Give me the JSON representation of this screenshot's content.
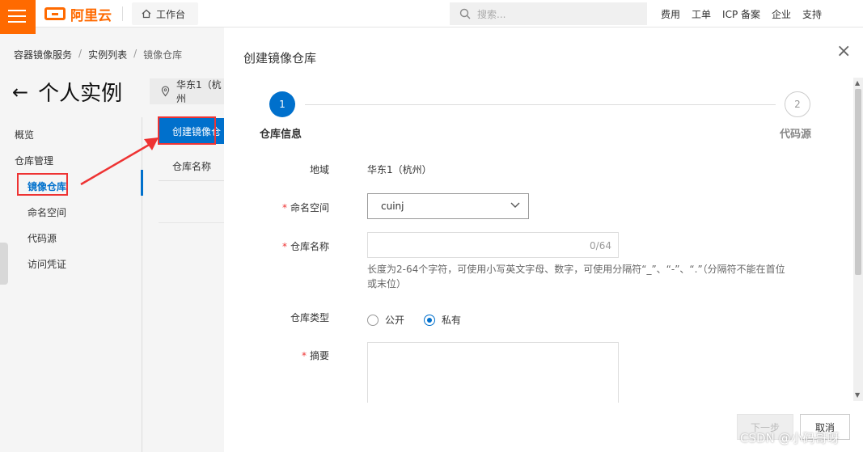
{
  "brand": {
    "name": "阿里云",
    "accent": "#ff6a00"
  },
  "topbar": {
    "workbench": "工作台",
    "search_placeholder": "搜索...",
    "nav": [
      "费用",
      "工单",
      "ICP 备案",
      "企业",
      "支持"
    ]
  },
  "breadcrumb": [
    "容器镜像服务",
    "实例列表",
    "镜像仓库"
  ],
  "page": {
    "title": "个人实例",
    "region": "华东1（杭州"
  },
  "leftnav": {
    "items": [
      "概览",
      "仓库管理",
      "镜像仓库",
      "命名空间",
      "代码源",
      "访问凭证"
    ]
  },
  "main": {
    "create_button": "创建镜像仓",
    "col_name": "仓库名称"
  },
  "modal": {
    "title": "创建镜像仓库",
    "close": "×",
    "steps": [
      {
        "num": "1",
        "label": "仓库信息"
      },
      {
        "num": "2",
        "label": "代码源"
      }
    ],
    "fields": {
      "region_label": "地域",
      "region_value": "华东1（杭州）",
      "namespace_label": "命名空间",
      "namespace_value": "cuinj",
      "repo_name_label": "仓库名称",
      "repo_name_count": "0/64",
      "repo_name_hint": "长度为2-64个字符，可使用小写英文字母、数字，可使用分隔符“_”、“-”、“.”（分隔符不能在首位或末位）",
      "repo_type_label": "仓库类型",
      "repo_type_public": "公开",
      "repo_type_private": "私有",
      "summary_label": "摘要",
      "required_mark": "*"
    },
    "next_button": "下一步",
    "cancel_button": "取消"
  },
  "watermark": "CSDN @小码哥呀",
  "colors": {
    "primary": "#0070cc",
    "annotation": "#ee3333"
  }
}
